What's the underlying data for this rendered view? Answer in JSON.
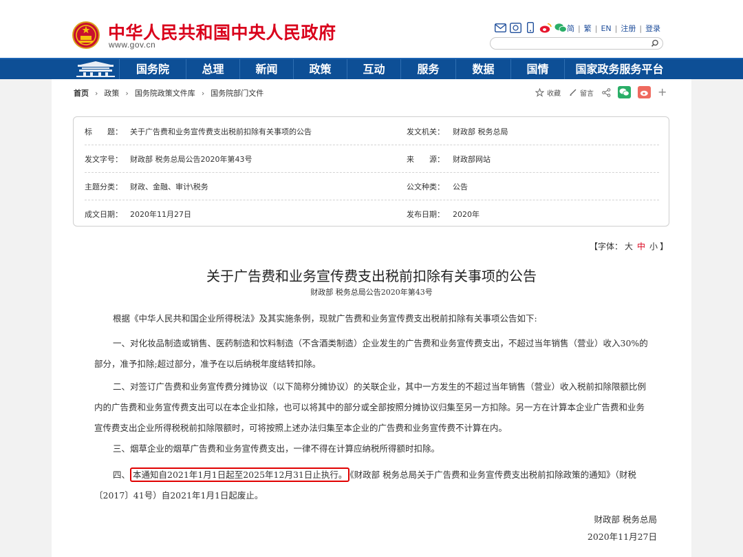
{
  "header": {
    "site_title": "中华人民共和国中央人民政府",
    "site_domain": "www.gov.cn",
    "links": [
      "简",
      "繁",
      "EN",
      "注册",
      "登录"
    ],
    "icons": [
      "mail-icon",
      "message-icon",
      "mobile-icon",
      "weibo-icon",
      "wechat-icon"
    ],
    "search_placeholder": ""
  },
  "nav": {
    "items": [
      "国务院",
      "总理",
      "新闻",
      "政策",
      "互动",
      "服务",
      "数据",
      "国情",
      "国家政务服务平台"
    ]
  },
  "breadcrumb": [
    "首页",
    "政策",
    "国务院政策文件库",
    "国务院部门文件"
  ],
  "tools": {
    "favorite": "收藏",
    "comment": "留言"
  },
  "info": {
    "title_label": "标　　题：",
    "title_value": "关于广告费和业务宣传费支出税前扣除有关事项的公告",
    "issuer_label": "发文机关：",
    "issuer_value": "财政部 税务总局",
    "docno_label": "发文字号：",
    "docno_value": "财政部 税务总局公告2020年第43号",
    "source_label": "来　　源：",
    "source_value": "财政部网站",
    "topic_label": "主题分类：",
    "topic_value": "财政、金融、审计\\税务",
    "type_label": "公文种类：",
    "type_value": "公告",
    "written_label": "成文日期：",
    "written_value": "2020年11月27日",
    "published_label": "发布日期：",
    "published_value": "2020年"
  },
  "font_size": {
    "open": "【字体：",
    "large": "大",
    "medium": "中",
    "small": "小",
    "close": "】"
  },
  "article": {
    "title": "关于广告费和业务宣传费支出税前扣除有关事项的公告",
    "subtitle": "财政部 税务总局公告2020年第43号",
    "p0": "根据《中华人民共和国企业所得税法》及其实施条例，现就广告费和业务宣传费支出税前扣除有关事项公告如下:",
    "p1": "一、对化妆品制造或销售、医药制造和饮料制造（不含酒类制造）企业发生的广告费和业务宣传费支出，不超过当年销售（营业）收入30%的部分，准予扣除;超过部分，准予在以后纳税年度结转扣除。",
    "p2": "二、对签订广告费和业务宣传费分摊协议（以下简称分摊协议）的关联企业，其中一方发生的不超过当年销售（营业）收入税前扣除限额比例内的广告费和业务宣传费支出可以在本企业扣除，也可以将其中的部分或全部按照分摊协议归集至另一方扣除。另一方在计算本企业广告费和业务宣传费支出企业所得税税前扣除限额时，可将按照上述办法归集至本企业的广告费和业务宣传费不计算在内。",
    "p3": "三、烟草企业的烟草广告费和业务宣传费支出，一律不得在计算应纳税所得额时扣除。",
    "p4_prefix": "四、",
    "p4_highlight": "本通知自2021年1月1日起至2025年12月31日止执行。",
    "p4_rest": "《财政部 税务总局关于广告费和业务宣传费支出税前扣除政策的通知》（财税〔2017〕41号）自2021年1月1日起废止。",
    "sign_org": "财政部 税务总局",
    "sign_date": "2020年11月27日"
  },
  "colors": {
    "brand_red": "#d9001b",
    "nav_blue": "#0d4f96",
    "highlight_red": "#e00000"
  }
}
